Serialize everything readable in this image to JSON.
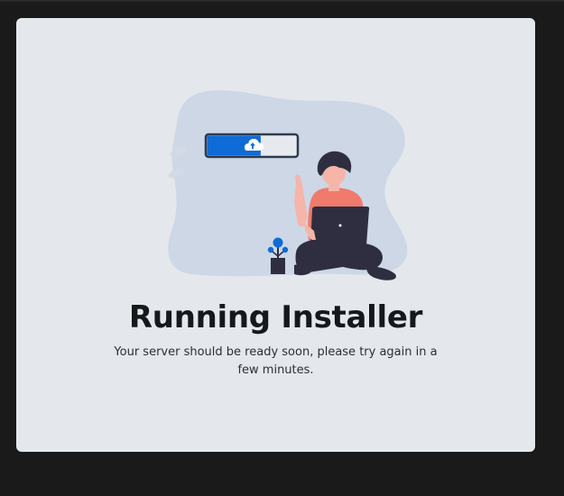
{
  "installer": {
    "title": "Running Installer",
    "message": "Your server should be ready soon, please try again in a few minutes.",
    "progress_fraction": 0.6
  },
  "colors": {
    "page_background": "#1a1a1a",
    "card_background": "#e4e8ec",
    "blob": "#cdd7e6",
    "progress_fill": "#0f6bd6",
    "accent_shirt": "#f07a6c",
    "dark": "#2f2e41"
  },
  "icons": [
    "cloud-upload-icon",
    "plant-icon",
    "leaf-icon"
  ]
}
